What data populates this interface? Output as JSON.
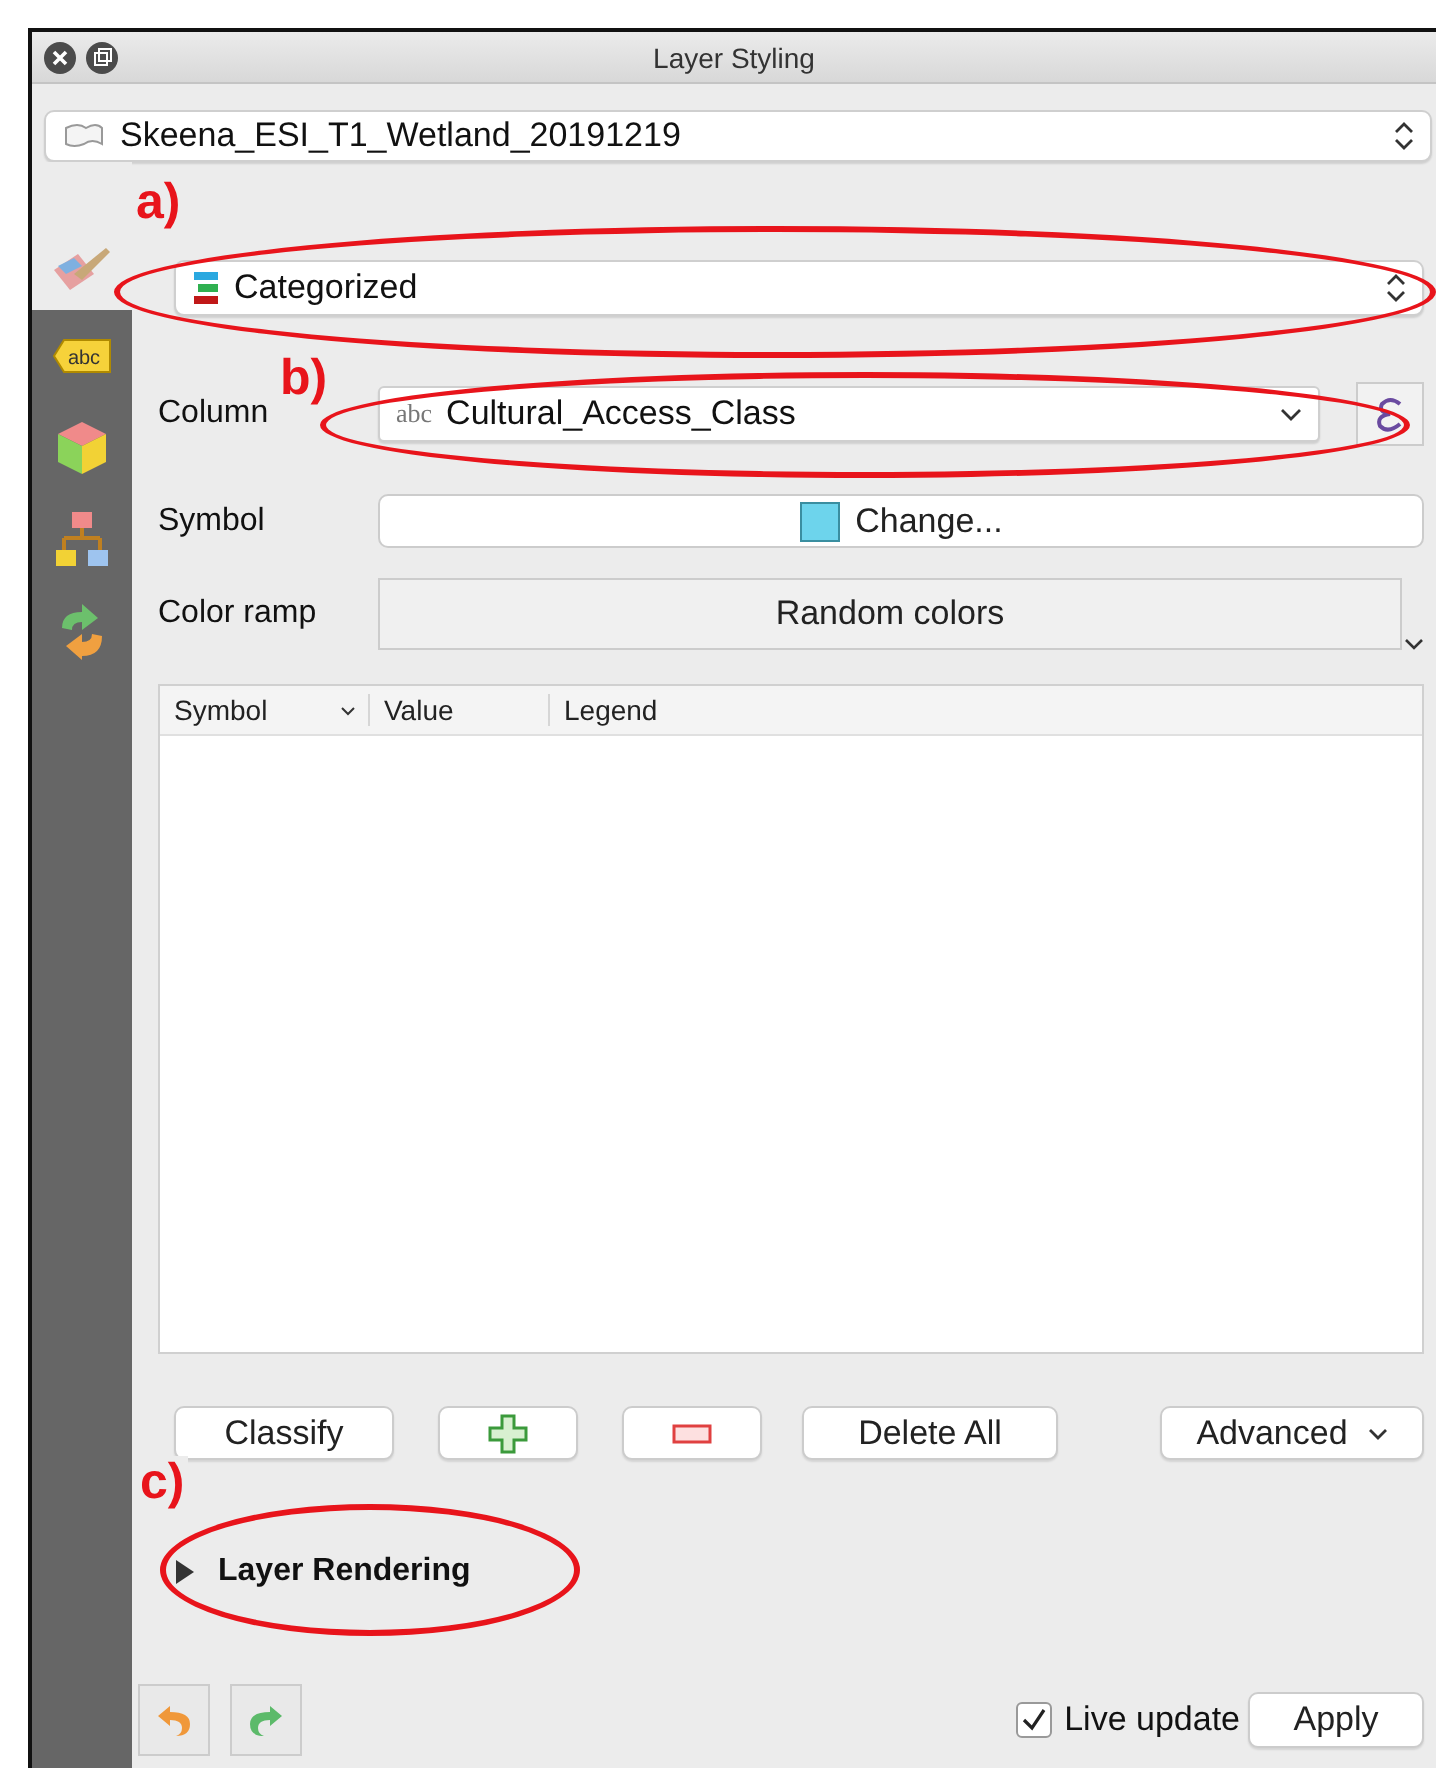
{
  "window": {
    "title": "Layer Styling"
  },
  "layer_select": {
    "value": "Skeena_ESI_T1_Wetland_20191219"
  },
  "side_tabs": [
    {
      "kind": "paint",
      "selected": true
    },
    {
      "kind": "label",
      "selected": false,
      "text": "abc"
    },
    {
      "kind": "cube",
      "selected": false
    },
    {
      "kind": "diagram",
      "selected": false
    },
    {
      "kind": "history",
      "selected": false
    }
  ],
  "renderer": {
    "value": "Categorized"
  },
  "column": {
    "label": "Column",
    "type_hint": "abc",
    "value": "Cultural_Access_Class"
  },
  "symbol": {
    "label": "Symbol",
    "button": "Change..."
  },
  "color_ramp": {
    "label": "Color ramp",
    "value": "Random colors"
  },
  "table": {
    "columns": [
      "Symbol",
      "Value",
      "Legend"
    ]
  },
  "buttons": [
    {
      "kind": "text",
      "label": "Classify"
    },
    {
      "kind": "add"
    },
    {
      "kind": "remove"
    },
    {
      "kind": "text",
      "label": "Delete All"
    },
    {
      "kind": "menu",
      "label": "Advanced"
    }
  ],
  "section": {
    "label": "Layer Rendering",
    "expanded": false
  },
  "footer": {
    "live_update": {
      "label": "Live update",
      "checked": true
    },
    "apply": "Apply"
  },
  "annotations": [
    {
      "label": "a)"
    },
    {
      "label": "b)"
    },
    {
      "label": "c)"
    }
  ]
}
